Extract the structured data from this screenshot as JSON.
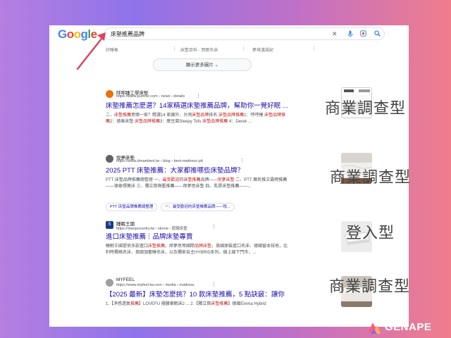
{
  "search": {
    "logo_letters": [
      "G",
      "o",
      "o",
      "g",
      "l",
      "e"
    ],
    "logo_colors": [
      "#4285f4",
      "#ea4335",
      "#fbbc05",
      "#4285f4",
      "#34a853",
      "#ea4335"
    ],
    "query": "床墊推薦品牌",
    "clear_icon": "close-icon",
    "mic_icon": "mic-icon",
    "lens_icon": "lens-icon",
    "search_icon": "search-icon"
  },
  "image_strip": {
    "labels": [
      "好睡象",
      "床墊百科 - 買眠名床",
      "夢境漢諾紀"
    ],
    "show_more": "顯示更多圖片"
  },
  "results": [
    {
      "site_name": "呼呼睡工學床墊",
      "url": "https://www.pumrur.com › news › details",
      "title": "床墊推薦怎麼選？14家精選床墊推薦品牌，幫助你一覺好眠 ...",
      "snippet_parts": [
        {
          "text": "二、",
          "hl": false
        },
        {
          "text": "床墊推薦",
          "hl": true
        },
        {
          "text": "買哪一家？精選14 家國外、台灣",
          "hl": false
        },
        {
          "text": "床墊品牌",
          "hl": true
        },
        {
          "text": "排名 ",
          "hl": false
        },
        {
          "text": "床墊品牌推薦",
          "hl": true
        },
        {
          "text": "1：呼呼睡 ",
          "hl": false
        },
        {
          "text": "床墊品牌推薦",
          "hl": true
        },
        {
          "text": "2：德泰床墊 ",
          "hl": false
        },
        {
          "text": "床墊品牌推薦",
          "hl": true
        },
        {
          "text": "3：眠豆腐Sleepy Tofu ",
          "hl": false
        },
        {
          "text": "床墊品牌推薦",
          "hl": true
        },
        {
          "text": " 4：Derek ...",
          "hl": false
        }
      ],
      "favicon_color": "#e8710a",
      "favicon_text": "",
      "tag": "商業調查型"
    },
    {
      "site_name": "悅夢床墊",
      "url": "https://www.dreambed.tw › blog › best-mattress-ptt",
      "title": "2025 PTT 床墊推薦：大家都推哪些床墊品牌？",
      "snippet_parts": [
        {
          "text": "PTT 床墊品牌推薦總整理 一、",
          "hl": false
        },
        {
          "text": "最受歡迎",
          "hl": true
        },
        {
          "text": "的",
          "hl": false
        },
        {
          "text": "床墊推薦",
          "hl": true
        },
        {
          "text": "品牌——",
          "hl": false
        },
        {
          "text": "悅夢床墊",
          "hl": true
        },
        {
          "text": " 二、PTT 鄉民推文霸榜推薦——德泰彈簧床 三、獨立筒無壓推薦——席夢思床墊 四、乳膠床墊推薦——...",
          "hl": false
        }
      ],
      "chips": [
        "PTT 床墊品牌推薦總整理",
        "一、最受歡迎的床墊推薦品牌——悅..."
      ],
      "favicon_color": "#5f6368",
      "favicon_text": "",
      "tag": "商業調查型"
    },
    {
      "site_name": "睡眠王國",
      "url": "https://sleepcountry.tw › Home › 認識床墊",
      "title": "進口床墊推薦｜品牌床墊專賣",
      "snippet_parts": [
        {
          "text": "睡眠王國提供多款進口",
          "hl": false
        },
        {
          "text": "床墊推薦",
          "hl": true
        },
        {
          "text": "，席夢思等國際",
          "hl": false
        },
        {
          "text": "品牌床墊",
          "hl": true
        },
        {
          "text": "，美國原裝進口名床、德國窗本技術，比利時獨格名床、美國頂奢睡名床，以及獨家自主HYBRID系列，線上線下門市，...",
          "hl": false
        }
      ],
      "favicon_color": "#1a3a8c",
      "favicon_text": "S",
      "tag": "登入型"
    },
    {
      "site_name": "MYFEEL",
      "url": "https://www.myfeel-tw.com › media › mattress",
      "title": "【2025 最新】床墊怎麼挑？10 款床墊推薦，5 點訣竅：讓你「沾 ...",
      "snippet_parts": [
        {
          "text": "1.【淨感透氣",
          "hl": false
        },
        {
          "text": "推薦",
          "hl": true
        },
        {
          "text": "】LOVEFU 撐腰樂眠床2 ... 2.【獨立筒",
          "hl": false
        },
        {
          "text": "床墊推薦",
          "hl": true
        },
        {
          "text": "】德國Emma Hybrid",
          "hl": false
        }
      ],
      "favicon_color": "#9e9e9e",
      "favicon_text": "",
      "tag": "商業調查型"
    }
  ],
  "brand": {
    "name": "GENAPE",
    "logo_colors": [
      "#ff5a7a",
      "#ffb14a",
      "#7c5cff"
    ]
  },
  "colors": {
    "link": "#1a0dab",
    "highlight": "#c5221f",
    "arrow": "#d9455f"
  }
}
